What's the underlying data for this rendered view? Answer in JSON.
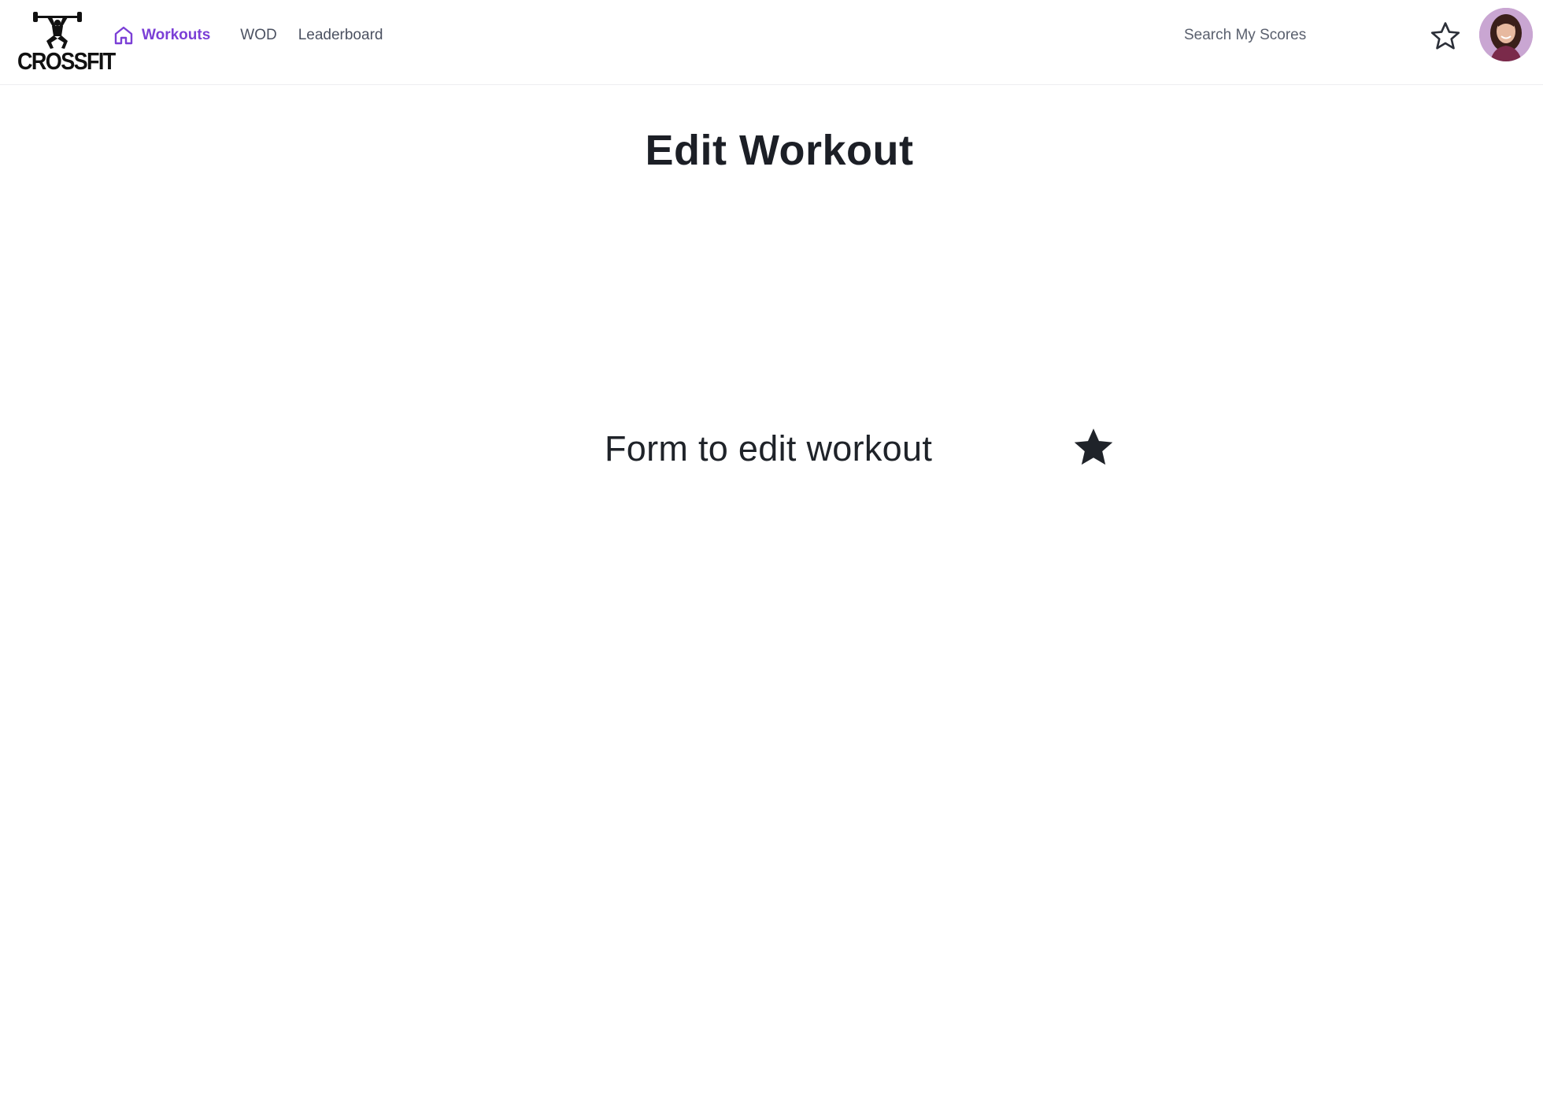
{
  "brand": {
    "logo_text": "CROSSFIT"
  },
  "nav": {
    "items": [
      {
        "label": "Workouts",
        "icon": "home-icon",
        "active": true
      },
      {
        "label": "WOD"
      },
      {
        "label": "Leaderboard"
      }
    ]
  },
  "search": {
    "placeholder": "Search My Scores",
    "value": ""
  },
  "header_actions": {
    "favorite_icon": "star-outline-icon",
    "avatar_icon": "user-avatar"
  },
  "main": {
    "title": "Edit Workout",
    "form_placeholder": "Form to  edit workout",
    "favorite_icon": "star-filled-icon"
  },
  "colors": {
    "accent": "#7b3fd6",
    "text": "#1f2329",
    "muted": "#4b5161",
    "border": "#eeeef1"
  }
}
